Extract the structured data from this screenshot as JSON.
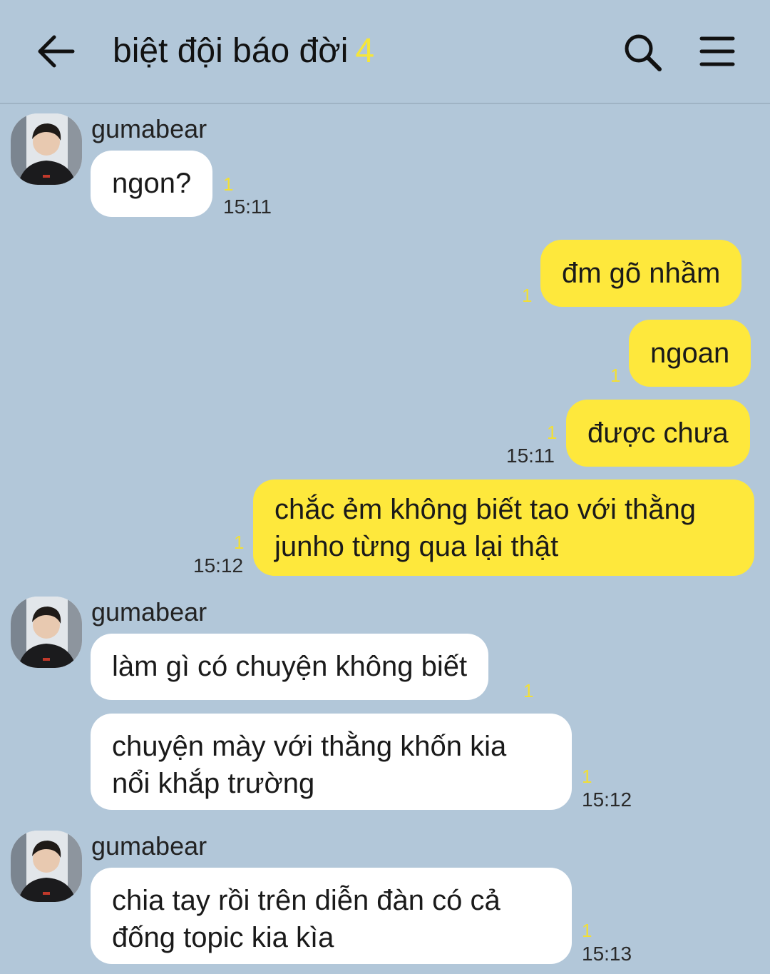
{
  "header": {
    "title": "biệt đội báo đời",
    "member_count": "4",
    "back_icon": "arrow-left-icon",
    "search_icon": "search-icon",
    "menu_icon": "hamburger-menu-icon"
  },
  "messages": [
    {
      "sender": "gumabear",
      "text": "ngon?",
      "unread": "1",
      "time": "15:11"
    },
    {
      "text": "đm gõ nhầm",
      "unread": "1"
    },
    {
      "text": "ngoan",
      "unread": "1"
    },
    {
      "text": "được chưa",
      "unread": "1",
      "time": "15:11"
    },
    {
      "lines": [
        "chắc ẻm không biết tao với thằng",
        "junho từng qua lại thật"
      ],
      "unread": "1",
      "time": "15:12"
    },
    {
      "sender": "gumabear",
      "text": "làm gì có chuyện không biết",
      "unread": "1"
    },
    {
      "lines": [
        "chuyện mày với thằng khốn kia",
        "nổi khắp trường"
      ],
      "unread": "1",
      "time": "15:12"
    },
    {
      "sender": "gumabear",
      "lines": [
        "chia tay rồi trên diễn đàn có cả",
        "đống topic kia kìa"
      ],
      "unread": "1",
      "time": "15:13"
    }
  ],
  "colors": {
    "background": "#b2c7d9",
    "outgoing_bubble": "#fee83c",
    "incoming_bubble": "#ffffff",
    "unread_count": "#f2df35"
  }
}
